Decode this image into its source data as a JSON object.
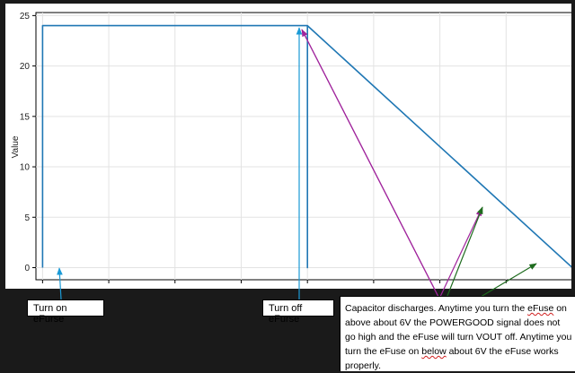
{
  "chart_data": {
    "type": "line",
    "ylabel": "Value",
    "xlabel": "",
    "ylim": [
      -1.2,
      25.3
    ],
    "xlim": [
      -0.1,
      8.0
    ],
    "yticks": [
      0,
      5,
      10,
      15,
      20,
      25
    ],
    "grid": true,
    "series": [
      {
        "color": "#1f77b4",
        "points": [
          [
            0,
            0
          ],
          [
            0,
            24
          ],
          [
            4,
            24
          ],
          [
            4,
            0
          ],
          [
            4,
            24
          ],
          [
            8,
            0
          ]
        ]
      }
    ],
    "colors": {
      "line": "#1f77b4",
      "arrow_cyan": "#1a9ad6",
      "arrow_purple": "#a0249c",
      "arrow_green": "#1e6b1e"
    }
  },
  "annotations": {
    "turn_on": "Turn on eFurse",
    "turn_off": "Turn off eFurse",
    "note": {
      "p1": "Capacitor discharges.  Anytime you turn the ",
      "w1": "eFuse",
      "p2": " on above about 6V the POWERGOOD signal does not go high and the eFuse will turn VOUT off.  Anytime you turn the eFuse on ",
      "w2": "below",
      "p3": " about 6V the eFuse works properly."
    }
  }
}
